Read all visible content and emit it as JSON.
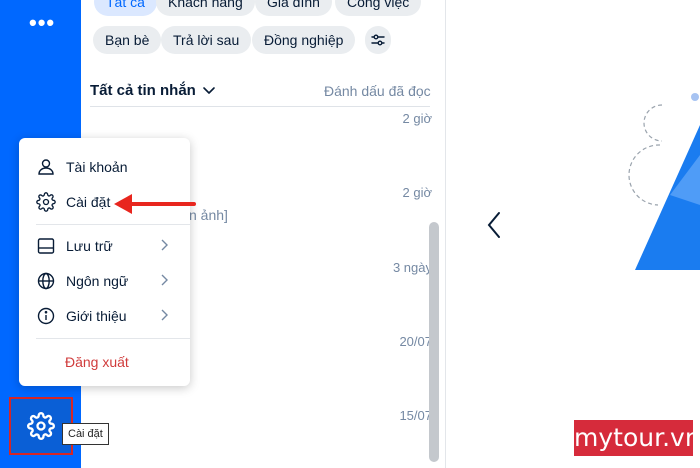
{
  "sidebar": {
    "more_label": "•••"
  },
  "settings_tooltip": "Cài đặt",
  "filters": {
    "row1": [
      "Tất cả",
      "Khách hàng",
      "Gia đình",
      "Công việc"
    ],
    "row2": [
      "Bạn bè",
      "Trả lời sau",
      "Đồng nghiệp"
    ]
  },
  "list": {
    "title": "Tất cả tin nhắn",
    "mark_read": "Đánh dấu đã đọc",
    "times": [
      "2 giờ",
      "2 giờ",
      "3 ngày",
      "20/07",
      "15/07"
    ],
    "preview_fragment": "n ảnh]"
  },
  "menu": {
    "items": [
      "Tài khoản",
      "Cài đặt",
      "Lưu trữ",
      "Ngôn ngữ",
      "Giới thiệu"
    ],
    "logout": "Đăng xuất"
  },
  "watermark": "mytour.vn",
  "colors": {
    "accent": "#0068ff",
    "danger": "#d03b3b",
    "highlight_box": "#d62626"
  }
}
